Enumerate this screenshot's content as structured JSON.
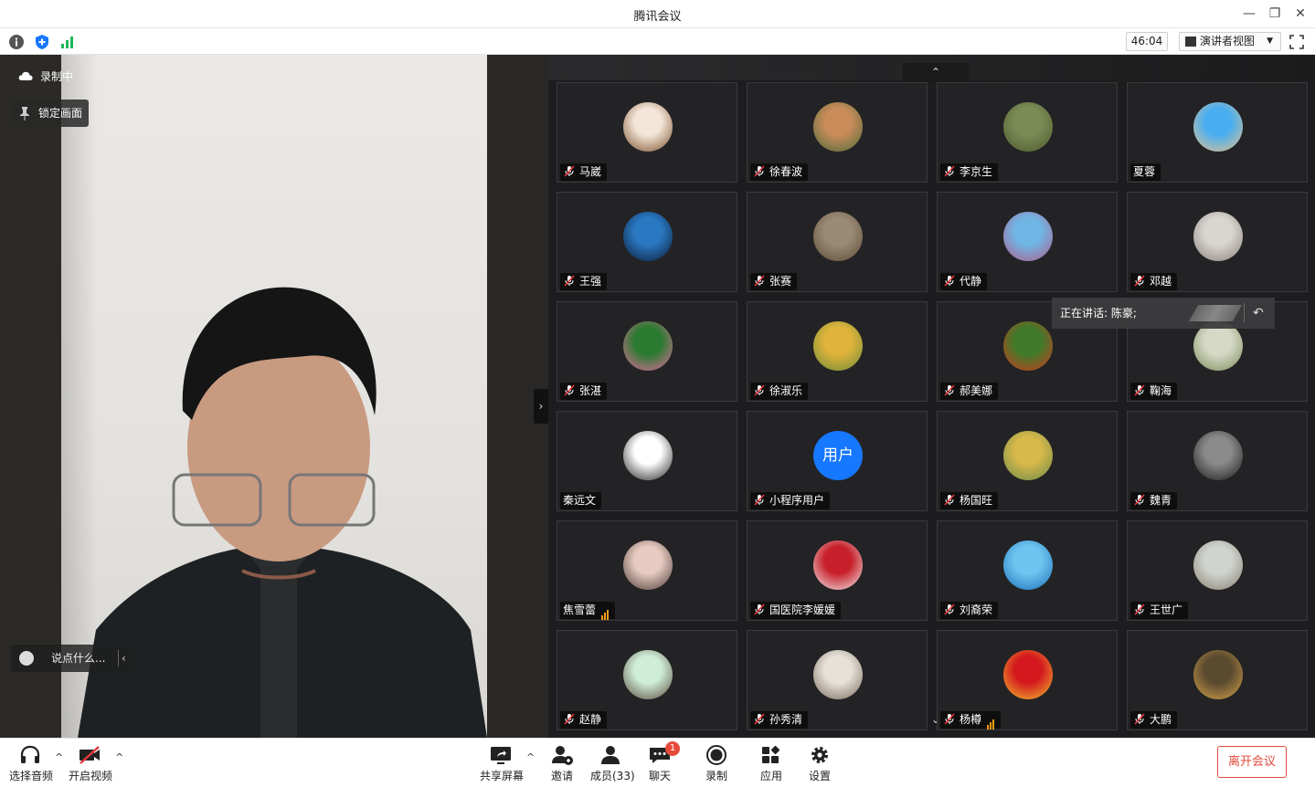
{
  "window": {
    "title": "腾讯会议",
    "min": "—",
    "restore": "❐",
    "close": "✕"
  },
  "infobar": {
    "timer": "46:04",
    "view_label": "演讲者视图",
    "caret": "▼"
  },
  "speaker": {
    "recording_label": "录制中",
    "lock_label": "锁定画面",
    "chat_placeholder": "说点什么...",
    "chat_caret": "‹"
  },
  "grid": {
    "up": "⌃",
    "down": "⌄",
    "collapse": "›",
    "speaking_text": "正在讲话: 陈豪;",
    "speaking_back": "↶",
    "participants": [
      {
        "name": "马崴",
        "muted": true,
        "avatar": [
          "#f3e6d8",
          "#7a4d2a"
        ]
      },
      {
        "name": "徐春波",
        "muted": true,
        "avatar": [
          "#c98b5a",
          "#4c6b3a"
        ]
      },
      {
        "name": "李京生",
        "muted": true,
        "avatar": [
          "#7c8a55",
          "#4d5b2e"
        ]
      },
      {
        "name": "夏蓉",
        "muted": false,
        "avatar": [
          "#49aef0",
          "#e8c28d"
        ]
      },
      {
        "name": "王强",
        "muted": true,
        "avatar": [
          "#2a78c2",
          "#0b1b33"
        ]
      },
      {
        "name": "张赛",
        "muted": true,
        "avatar": [
          "#9a8a76",
          "#5d4b36"
        ]
      },
      {
        "name": "代静",
        "muted": true,
        "avatar": [
          "#6fb6e4",
          "#b45a8a"
        ]
      },
      {
        "name": "邓越",
        "muted": true,
        "avatar": [
          "#d9d6d2",
          "#8b8079"
        ]
      },
      {
        "name": "张湛",
        "muted": true,
        "avatar": [
          "#2a7a30",
          "#e56ba0"
        ]
      },
      {
        "name": "徐淑乐",
        "muted": true,
        "avatar": [
          "#e0b43a",
          "#6c8a3a"
        ]
      },
      {
        "name": "郝美娜",
        "muted": true,
        "avatar": [
          "#3e7a2a",
          "#d33a20"
        ]
      },
      {
        "name": "鞠海",
        "muted": true,
        "avatar": [
          "#d6d9c6",
          "#7b8c5b"
        ]
      },
      {
        "name": "秦远文",
        "muted": false,
        "avatar": [
          "#ffffff",
          "#222222"
        ]
      },
      {
        "name": "小程序用户",
        "muted": true,
        "avatar": [
          "#1677ff",
          "#1677ff"
        ],
        "avatar_text": "用户"
      },
      {
        "name": "杨国旺",
        "muted": true,
        "avatar": [
          "#d8b84a",
          "#6a8a4a"
        ]
      },
      {
        "name": "魏青",
        "muted": true,
        "avatar": [
          "#8a8a8a",
          "#1a1a1a"
        ]
      },
      {
        "name": "焦雪蕾",
        "muted": false,
        "signal": true,
        "avatar": [
          "#e8ccc2",
          "#4a3a35"
        ]
      },
      {
        "name": "国医院李媛媛",
        "muted": true,
        "avatar": [
          "#c8202a",
          "#f0f0f0"
        ]
      },
      {
        "name": "刘裔荣",
        "muted": true,
        "avatar": [
          "#6ec6f0",
          "#1f6fb8"
        ]
      },
      {
        "name": "王世广",
        "muted": true,
        "avatar": [
          "#cfd4d0",
          "#8a8070"
        ]
      },
      {
        "name": "赵静",
        "muted": true,
        "avatar": [
          "#cfeed8",
          "#5a4a3a"
        ]
      },
      {
        "name": "孙秀清",
        "muted": true,
        "avatar": [
          "#e6e2da",
          "#7a6a5a"
        ]
      },
      {
        "name": "杨樽",
        "muted": true,
        "signal": true,
        "avatar": [
          "#d4181e",
          "#f0c030"
        ]
      },
      {
        "name": "大鹏",
        "muted": true,
        "avatar": [
          "#5a4a30",
          "#d8a34a"
        ]
      }
    ]
  },
  "toolbar": {
    "audio": "选择音频",
    "video": "开启视频",
    "share": "共享屏幕",
    "invite": "邀请",
    "members": "成员(33)",
    "chat": "聊天",
    "chat_badge": "1",
    "record": "录制",
    "apps": "应用",
    "settings": "设置",
    "leave": "离开会议",
    "caret": "^"
  }
}
